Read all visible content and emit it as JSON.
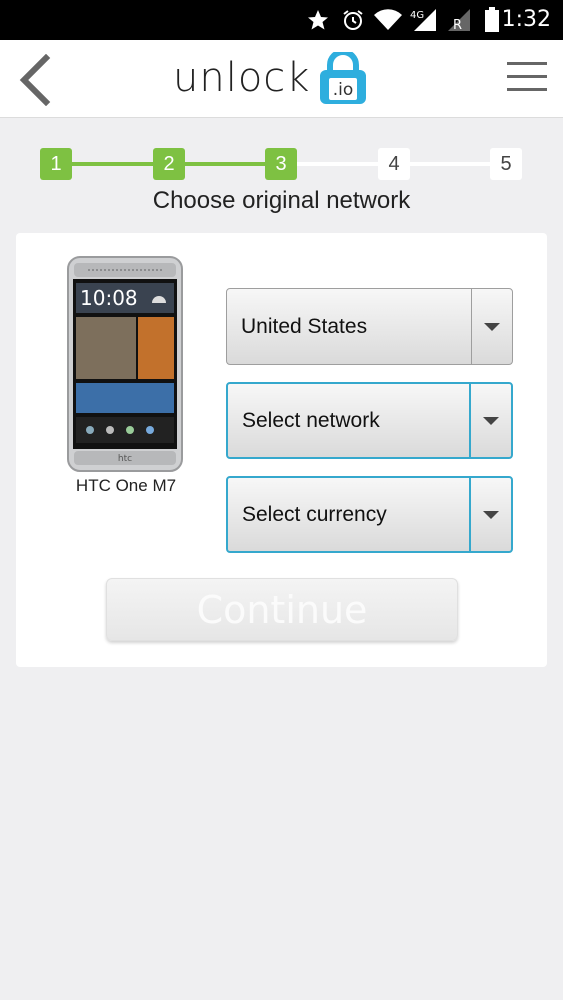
{
  "status_bar": {
    "time": "1:32",
    "network_type": "4G",
    "icons": [
      "star-icon",
      "alarm-icon",
      "wifi-icon",
      "signal-icon",
      "signal-roaming-icon",
      "battery-icon"
    ]
  },
  "header": {
    "logo_text": "unlock",
    "logo_badge": ".io",
    "back_icon": "chevron-left-icon",
    "menu_icon": "hamburger-menu-icon"
  },
  "stepper": {
    "steps": [
      {
        "label": "1",
        "state": "done"
      },
      {
        "label": "2",
        "state": "done"
      },
      {
        "label": "3",
        "state": "done"
      },
      {
        "label": "4",
        "state": "todo"
      },
      {
        "label": "5",
        "state": "todo"
      }
    ],
    "current_step": 3
  },
  "page_title": "Choose original network",
  "device": {
    "name": "HTC One M7",
    "screen_time": "10:08",
    "brand_mark": "htc"
  },
  "form": {
    "country": {
      "value": "United States"
    },
    "network": {
      "value": "Select network"
    },
    "currency": {
      "value": "Select currency"
    },
    "continue_label": "Continue"
  },
  "colors": {
    "accent_green": "#7ec142",
    "focus_blue": "#35a8cd",
    "logo_blue": "#2eaede"
  }
}
